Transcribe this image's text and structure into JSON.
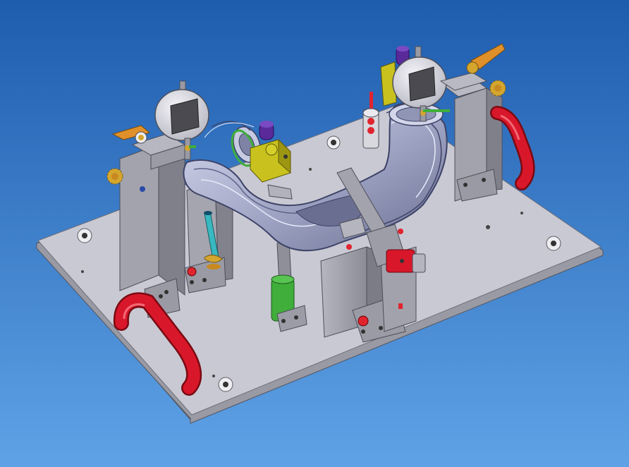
{
  "scene": {
    "background_top": "#1e5cae",
    "background_bottom": "#5fa3e6",
    "plate_color": "#c9c9d3",
    "plate_edge": "#8a8a94",
    "block_color": "#a9a9b3",
    "block_dark": "#7b7b86",
    "handle_color": "#d9172b",
    "lever_color": "#e0902a",
    "knob_color": "#d4a62e",
    "clamp_color": "#c9c21e",
    "pin_purple": "#5a2a9a",
    "sleeve_green": "#3fae3a",
    "rod_cyan": "#39b8c0",
    "screw_red": "#e0242e",
    "part_color": "#a8aecb",
    "part_dark": "#5d6387",
    "gauge_face": "#e4e4ea",
    "gauge_screen": "#4a4a50"
  },
  "components": [
    {
      "name": "base-plate-icon"
    },
    {
      "name": "left-dial-indicator-icon"
    },
    {
      "name": "right-dial-indicator-icon"
    },
    {
      "name": "left-carry-handle-icon"
    },
    {
      "name": "right-carry-handle-icon"
    },
    {
      "name": "tube-part-icon"
    },
    {
      "name": "toggle-clamp-icon"
    }
  ]
}
